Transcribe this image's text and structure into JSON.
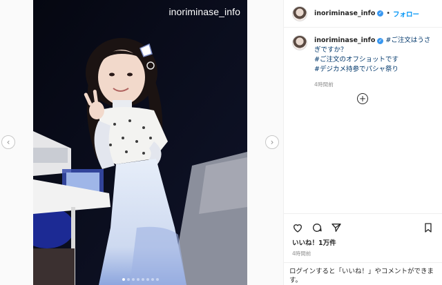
{
  "post": {
    "watermark": "inoriminase_info",
    "carousel_dots": 8,
    "active_dot": 0
  },
  "header": {
    "username": "inoriminase_info",
    "separator": "•",
    "follow_label": "フォロー"
  },
  "caption": {
    "username": "inoriminase_info",
    "line1": "#ご注文はうさぎですか？",
    "line2": "#ご注文のオフショットです",
    "line3": "#デジカメ持参でパシャ祭り",
    "time": "4時間前"
  },
  "actions": {
    "likes": "いいね！1万件",
    "time": "4時間前",
    "login_prompt": "ログインすると「いいね！」やコメントができます。"
  },
  "icons": {
    "prev": "chevron-left-icon",
    "next": "chevron-right-icon",
    "verified": "verified-badge-icon",
    "add_comment": "plus-circle-icon",
    "like": "heart-icon",
    "comment": "comment-bubble-icon",
    "share": "paper-plane-icon",
    "save": "bookmark-icon"
  },
  "colors": {
    "accent": "#0095f6",
    "verified": "#3897f0",
    "hashtag": "#00376b",
    "muted": "#8e8e8e"
  }
}
